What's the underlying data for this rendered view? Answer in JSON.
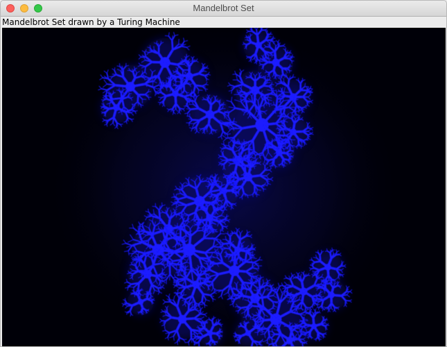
{
  "window": {
    "title": "Mandelbrot Set",
    "controls": {
      "close_icon": "close-icon",
      "minimize_icon": "minimize-icon",
      "zoom_icon": "zoom-icon"
    }
  },
  "heading": {
    "text": "Mandelbrot Set drawn by a Turing Machine"
  },
  "canvas": {
    "background_color": "#000008",
    "fractal_color": "#1a1aff",
    "glow_color": "#0a0a7a"
  }
}
